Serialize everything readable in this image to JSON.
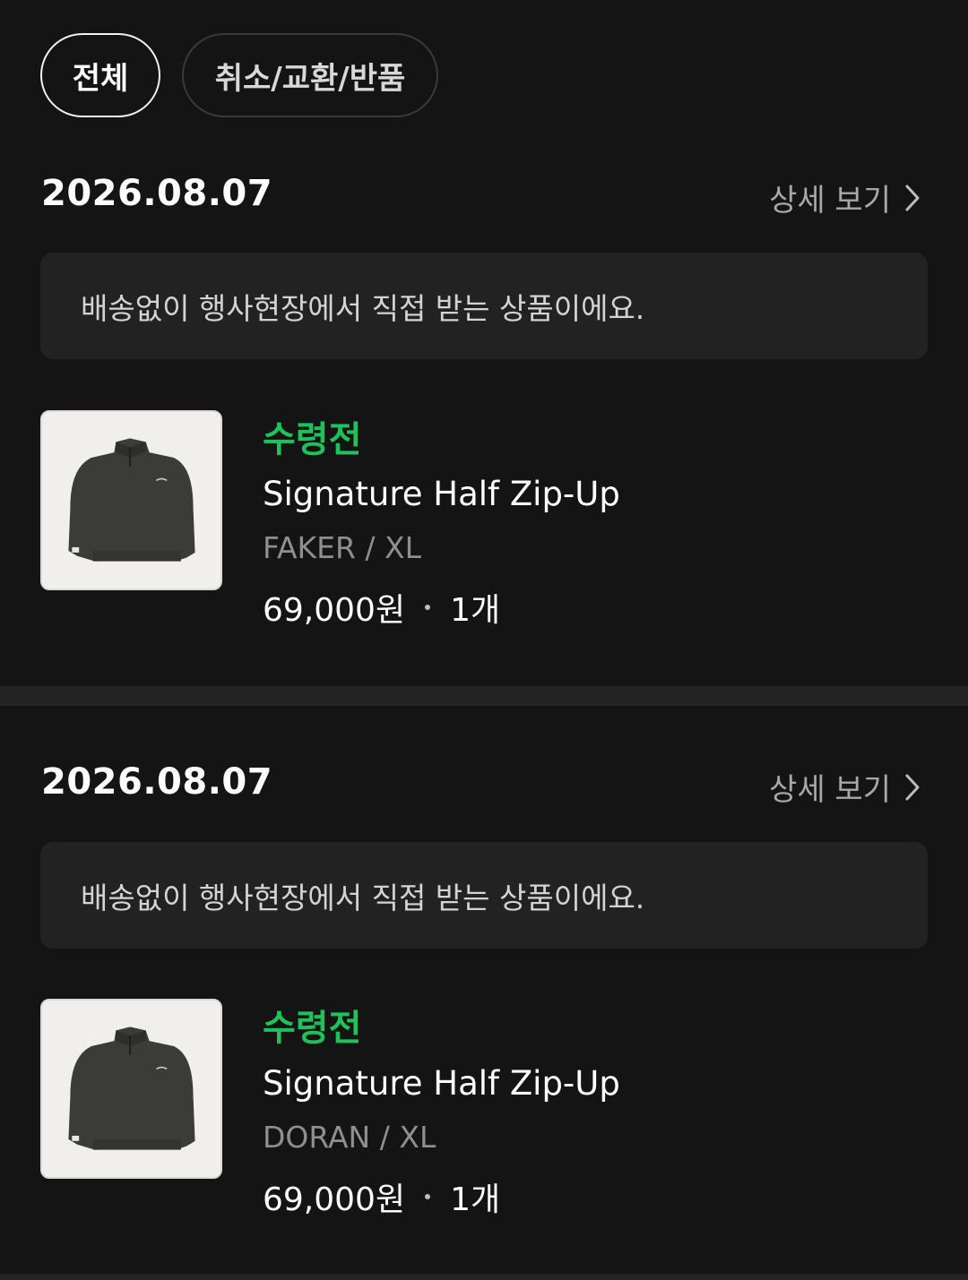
{
  "filters": {
    "all_label": "전체",
    "cancel_label": "취소/교환/반품"
  },
  "orders": [
    {
      "date": "2026.08.07",
      "detail_label": "상세 보기",
      "notice": "배송없이 행사현장에서 직접 받는 상품이에요.",
      "status": "수령전",
      "product_name": "Signature Half Zip-Up",
      "option": "FAKER / XL",
      "price": "69,000원",
      "quantity": "1개"
    },
    {
      "date": "2026.08.07",
      "detail_label": "상세 보기",
      "notice": "배송없이 행사현장에서 직접 받는 상품이에요.",
      "status": "수령전",
      "product_name": "Signature Half Zip-Up",
      "option": "DORAN / XL",
      "price": "69,000원",
      "quantity": "1개"
    }
  ],
  "colors": {
    "background": "#141414",
    "status_green": "#1fc15b",
    "notice_bg": "#222222",
    "muted_text": "#8f8f8f"
  },
  "icons": {
    "detail_arrow": "chevron-right-icon",
    "product_image": "half-zip-sweatshirt-image"
  }
}
